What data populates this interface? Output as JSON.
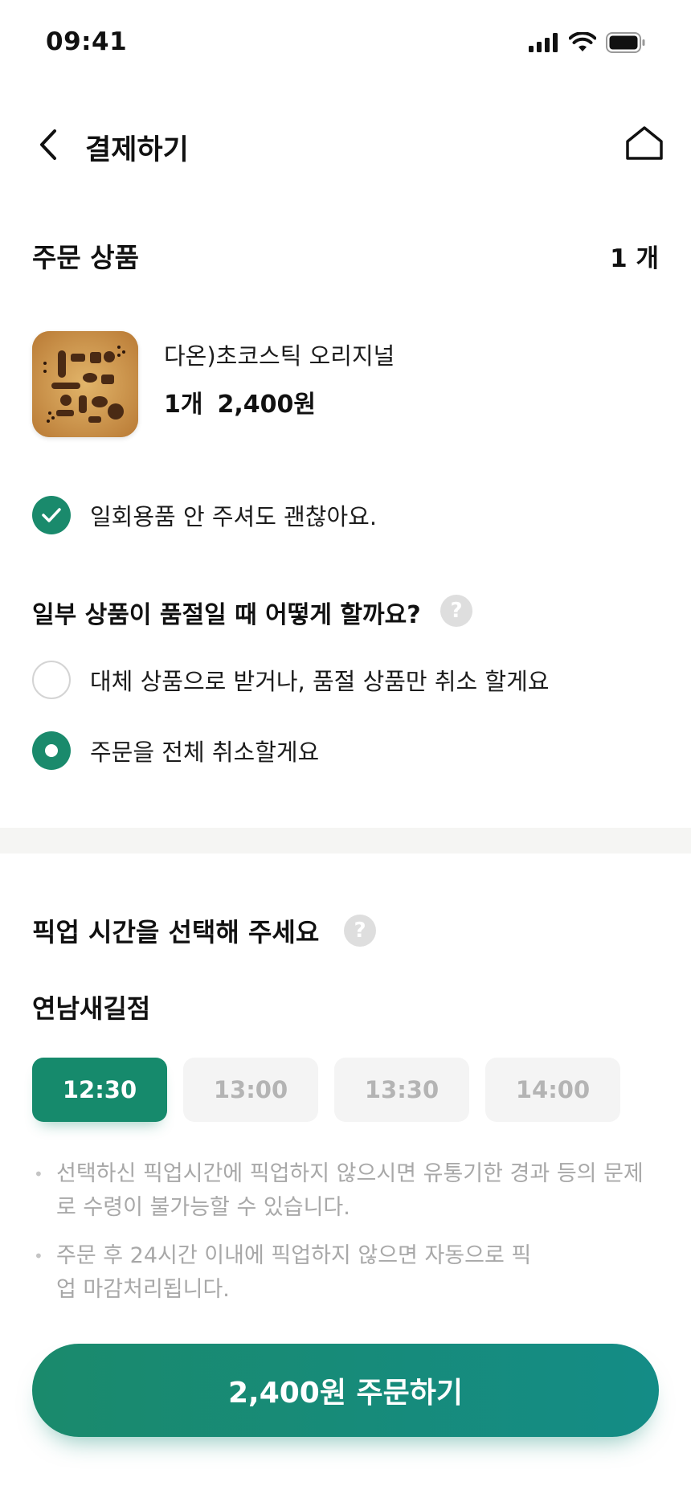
{
  "status_bar": {
    "time": "09:41"
  },
  "header": {
    "title": "결제하기"
  },
  "order_items": {
    "title": "주문 상품",
    "count": "1 개",
    "product": {
      "name": "다온)초코스틱 오리지널",
      "qty": "1개",
      "price": "2,400원"
    }
  },
  "disposables": {
    "label": "일회용품 안 주셔도 괜찮아요.",
    "checked": true
  },
  "sold_out": {
    "title": "일부 상품이 품절일 때 어떻게 할까요?",
    "options": [
      {
        "label": "대체 상품으로 받거나, 품절 상품만 취소 할게요",
        "selected": false
      },
      {
        "label": "주문을 전체 취소할게요",
        "selected": true
      }
    ]
  },
  "pickup": {
    "title": "픽업 시간을 선택해 주세요",
    "store": "연남새길점",
    "slots": [
      {
        "label": "12:30",
        "active": true
      },
      {
        "label": "13:00",
        "active": false
      },
      {
        "label": "13:30",
        "active": false
      },
      {
        "label": "14:00",
        "active": false
      }
    ],
    "notes": [
      "선택하신 픽업시간에 픽업하지 않으시면 유통기한 경과 등의 문제로 수령이 불가능할 수 있습니다.",
      "주문 후 24시간 이내에 픽업하지 않으면 자동으로 픽업 마감처리됩니다."
    ]
  },
  "order_button": {
    "label": "2,400원 주문하기"
  },
  "colors": {
    "accent": "#1a8a6c",
    "accent_end": "#148c86",
    "disabled_slot": "#f4f4f4",
    "note_text": "#a8a8a8"
  }
}
